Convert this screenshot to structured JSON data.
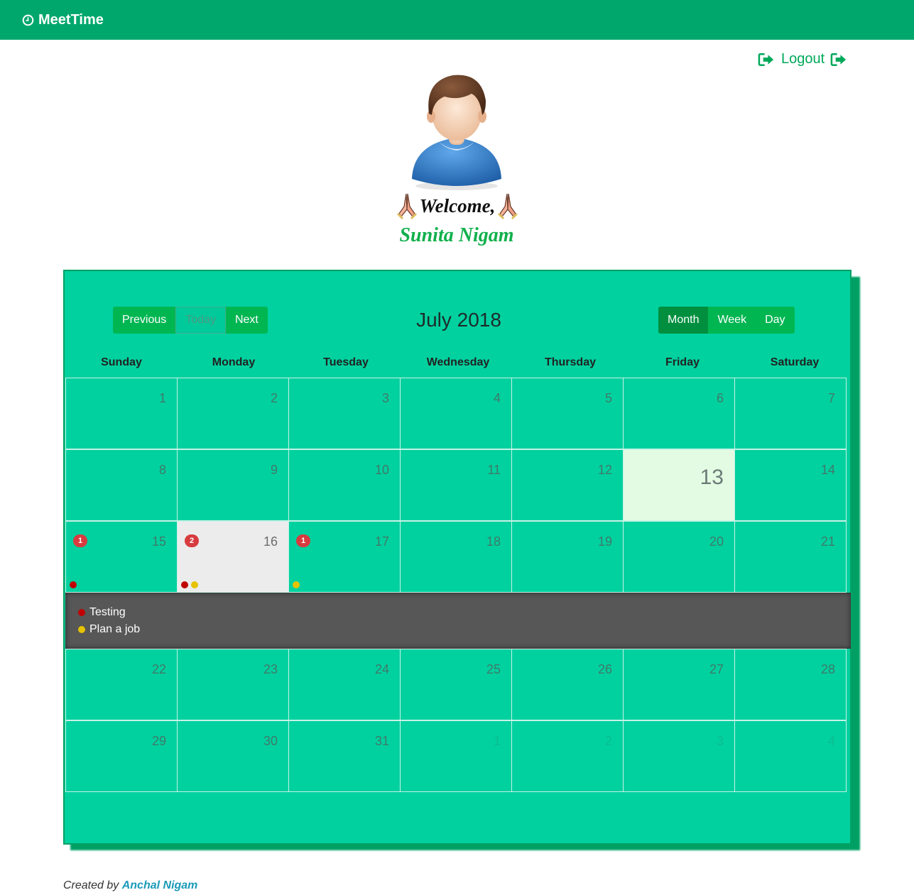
{
  "navbar": {
    "brand": "MeetTime",
    "brand_icon": "clock-icon"
  },
  "logout": {
    "label": "Logout",
    "icon": "sign-out-icon"
  },
  "profile": {
    "welcome": "Welcome,",
    "name": "Sunita Nigam"
  },
  "calendar": {
    "title": "July 2018",
    "nav": {
      "previous": "Previous",
      "today": "Today",
      "next": "Next"
    },
    "views": {
      "month": "Month",
      "week": "Week",
      "day": "Day",
      "active": "Month"
    },
    "weekdays": [
      "Sunday",
      "Monday",
      "Tuesday",
      "Wednesday",
      "Thursday",
      "Friday",
      "Saturday"
    ],
    "weeks": [
      [
        "1",
        "2",
        "3",
        "4",
        "5",
        "6",
        "7"
      ],
      [
        "8",
        "9",
        "10",
        "11",
        "12",
        "13",
        "14"
      ],
      [
        "15",
        "16",
        "17",
        "18",
        "19",
        "20",
        "21"
      ],
      [
        "22",
        "23",
        "24",
        "25",
        "26",
        "27",
        "28"
      ],
      [
        "29",
        "30",
        "31",
        "1",
        "2",
        "3",
        "4"
      ]
    ],
    "today": "13",
    "selected": "16",
    "event_badges": {
      "15": "1",
      "16": "2",
      "17": "1"
    },
    "colors": {
      "red": "#c00000",
      "yellow": "#e6c300"
    },
    "events": [
      {
        "title": "Testing",
        "color": "#c00000"
      },
      {
        "title": "Plan a job",
        "color": "#e6c300"
      }
    ]
  },
  "footer": {
    "prefix": "Created by",
    "author": "Anchal Nigam"
  }
}
